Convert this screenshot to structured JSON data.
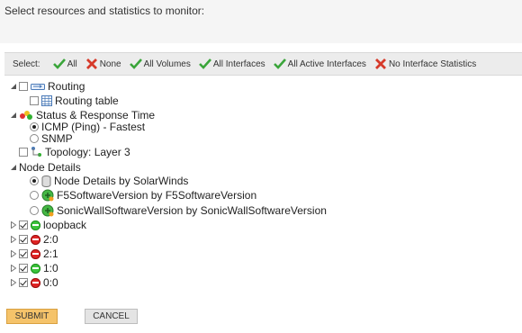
{
  "header": {
    "title": "Select resources and statistics to monitor:"
  },
  "select_bar": {
    "label": "Select:",
    "all": "All",
    "none": "None",
    "all_volumes": "All Volumes",
    "all_interfaces": "All Interfaces",
    "all_active_interfaces": "All Active Interfaces",
    "no_interface_statistics": "No Interface Statistics"
  },
  "tree": {
    "routing": {
      "label": "Routing",
      "checked": false
    },
    "routing_table": {
      "label": "Routing table",
      "checked": false
    },
    "status_response": {
      "label": "Status & Response Time"
    },
    "icmp": {
      "label": "ICMP (Ping) - Fastest",
      "selected": true
    },
    "snmp": {
      "label": "SNMP",
      "selected": false
    },
    "topology": {
      "label": "Topology: Layer 3",
      "checked": false
    },
    "node_details": {
      "label": "Node Details"
    },
    "node_solarwinds": {
      "label": "Node Details by SolarWinds",
      "selected": true
    },
    "f5": {
      "label": "F5SoftwareVersion by F5SoftwareVersion",
      "selected": false
    },
    "sonicwall": {
      "label": "SonicWallSoftwareVersion by SonicWallSoftwareVersion",
      "selected": false
    },
    "interfaces": [
      {
        "label": "loopback",
        "status": "up",
        "checked": true
      },
      {
        "label": "2:0",
        "status": "down",
        "checked": true
      },
      {
        "label": "2:1",
        "status": "down",
        "checked": true
      },
      {
        "label": "1:0",
        "status": "up",
        "checked": true
      },
      {
        "label": "0:0",
        "status": "down",
        "checked": true
      }
    ]
  },
  "buttons": {
    "submit": "SUBMIT",
    "cancel": "CANCEL"
  },
  "colors": {
    "submit_bg": "#f5c36a",
    "check_green": "#3aa53a",
    "x_red": "#d63a2a"
  }
}
